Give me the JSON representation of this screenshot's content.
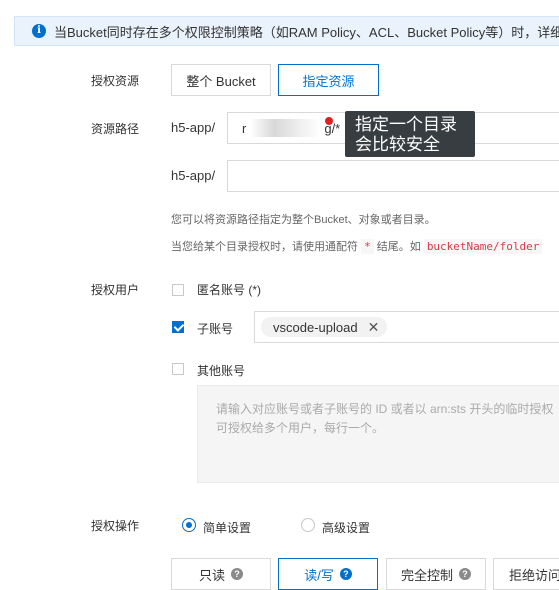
{
  "info": {
    "text": "当Bucket同时存在多个权限控制策略（如RAM Policy、ACL、Bucket Policy等）时，详细鉴权"
  },
  "resource": {
    "label": "授权资源",
    "options": [
      "整个 Bucket",
      "指定资源"
    ],
    "selected": "指定资源"
  },
  "path": {
    "label": "资源路径",
    "prefix1": "h5-app/",
    "value1_start": "r",
    "value1_end": "g/*",
    "prefix2": "h5-app/",
    "value2": "",
    "tooltip_line1": "指定一个目录",
    "tooltip_line2": "会比较安全"
  },
  "help": {
    "line1": "您可以将资源路径指定为整个Bucket、对象或者目录。",
    "line2_a": "当您给某个目录授权时，请使用通配符",
    "line2_code1": "*",
    "line2_b": "结尾。如",
    "line2_code2": "bucketName/folder"
  },
  "users": {
    "label": "授权用户",
    "anonymous": "匿名账号 (*)",
    "sub_account": "子账号",
    "sub_account_tag": "vscode-upload",
    "tag_remove": "✕",
    "other_account": "其他账号",
    "other_placeholder_line1": "请输入对应账号或者子账号的 ID 或者以 arn:sts 开头的临时授权",
    "other_placeholder_line2": "可授权给多个用户，每行一个。"
  },
  "operation": {
    "label": "授权操作",
    "simple": "简单设置",
    "advanced": "高级设置",
    "selected": "simple",
    "perms": [
      "只读",
      "读/写",
      "完全控制",
      "拒绝访问"
    ],
    "help_glyph": "?"
  },
  "colors": {
    "accent": "#0070cc",
    "info_bg": "#eaf2fc",
    "tooltip_bg": "#373d41",
    "code_text": "#d73a49"
  }
}
